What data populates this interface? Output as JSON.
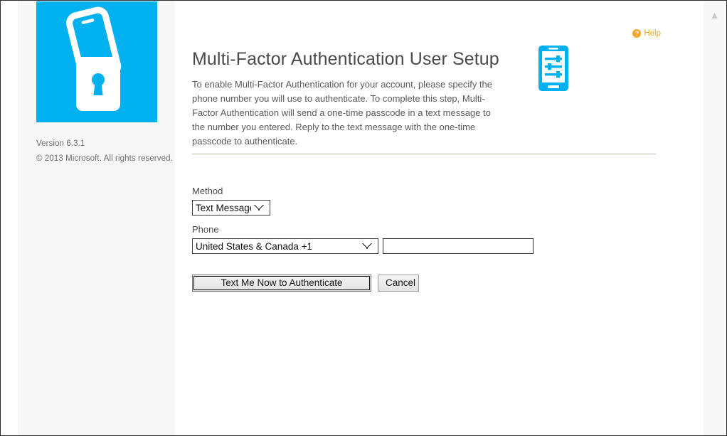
{
  "sidebar": {
    "logo_icon": "phone-padlock-logo",
    "logo_bg_color": "#00b0ef",
    "version": "Version 6.3.1",
    "copyright": "© 2013 Microsoft. All rights reserved."
  },
  "header": {
    "help_label": "Help",
    "help_icon": "question-mark-circle-icon",
    "help_color": "#f0a02a"
  },
  "main": {
    "title": "Multi-Factor Authentication User Setup",
    "intro": "To enable Multi-Factor Authentication for your account, please specify the phone number you will use to authenticate. To complete this step, Multi-Factor Authentication will send a one-time passcode in a text message to the number you entered. Reply to the text message with the one-time passcode to authenticate.",
    "badge_icon": "mobile-phone-settings-icon",
    "badge_color": "#00b0ef",
    "divider_color": "#b9b8a4"
  },
  "form": {
    "method_label": "Method",
    "method_value": "Text Message",
    "method_options": [
      "Text Message"
    ],
    "phone_label": "Phone",
    "country_value": "United States & Canada +1",
    "country_options": [
      "United States & Canada +1"
    ],
    "phone_number_value": "",
    "phone_number_placeholder": ""
  },
  "actions": {
    "submit_label": "Text Me Now to Authenticate",
    "cancel_label": "Cancel"
  },
  "scrollbar": {
    "up_arrow_icon": "chevron-up-icon"
  }
}
